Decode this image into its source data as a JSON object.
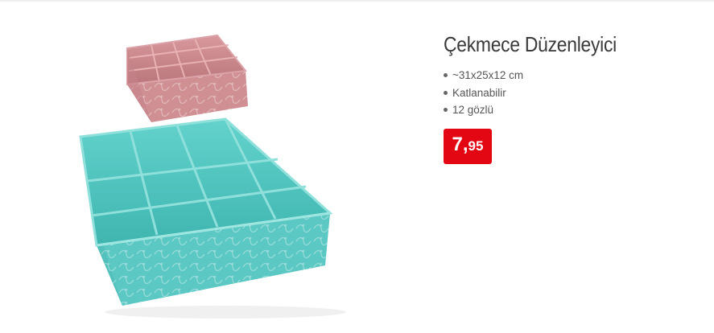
{
  "product": {
    "title": "Çekmece Düzenleyici",
    "features": [
      "~31x25x12 cm",
      "Katlanabilir",
      "12 gözlü"
    ],
    "price": {
      "integer": "7",
      "separator": ",",
      "decimal": "95"
    },
    "image": {
      "icon": "drawer-organizer-illustration"
    }
  },
  "colors": {
    "price_badge": "#e30613",
    "title_text": "#3a3a3a",
    "organizer_pink": "#cf8f93",
    "organizer_teal": "#5fcfc9"
  }
}
